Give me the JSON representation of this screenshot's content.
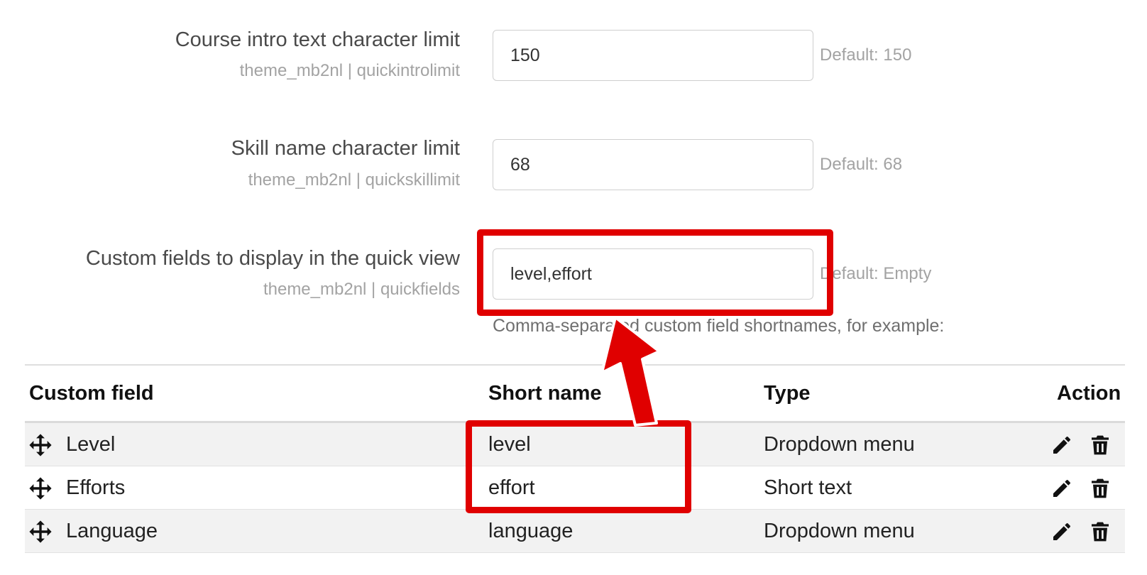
{
  "settings": [
    {
      "label": "Course intro text character limit",
      "key": "theme_mb2nl | quickintrolimit",
      "value": "150",
      "default": "Default: 150"
    },
    {
      "label": "Skill name character limit",
      "key": "theme_mb2nl | quickskillimit",
      "value": "68",
      "default": "Default: 68"
    },
    {
      "label": "Custom fields to display in the quick view",
      "key": "theme_mb2nl | quickfields",
      "value": "level,effort",
      "default": "Default: Empty",
      "description": "Comma-separated custom field shortnames, for example:"
    }
  ],
  "table": {
    "headers": {
      "custom_field": "Custom field",
      "short_name": "Short name",
      "type": "Type",
      "action": "Action"
    },
    "rows": [
      {
        "name": "Level",
        "shortname": "level",
        "type": "Dropdown menu"
      },
      {
        "name": "Efforts",
        "shortname": "effort",
        "type": "Short text"
      },
      {
        "name": "Language",
        "shortname": "language",
        "type": "Dropdown menu"
      }
    ]
  },
  "icons": {
    "move": "move-icon",
    "edit": "pencil-icon",
    "delete": "trash-icon"
  },
  "colors": {
    "highlight": "#e00000",
    "row_stripe": "#f2f2f2"
  }
}
